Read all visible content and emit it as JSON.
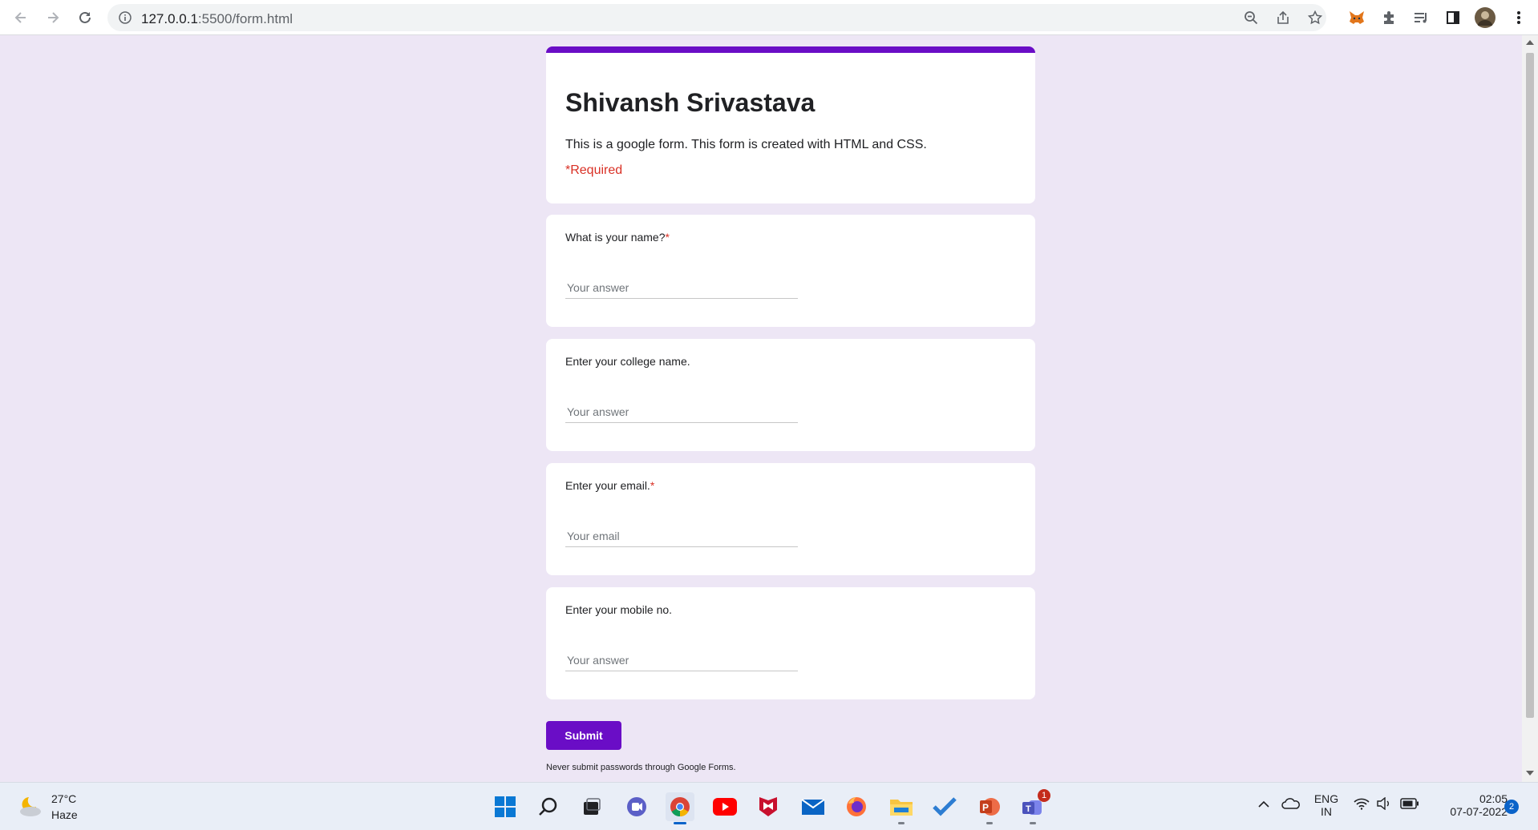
{
  "browser": {
    "url_host": "127.0.0.1",
    "url_rest": ":5500/form.html"
  },
  "form": {
    "title": "Shivansh Srivastava",
    "description": "This is a google form. This form is created with HTML and CSS.",
    "required_note": "*Required",
    "questions": [
      {
        "label": "What is your name?",
        "required": "*",
        "placeholder": "Your answer"
      },
      {
        "label": "Enter your college name.",
        "required": "",
        "placeholder": "Your answer"
      },
      {
        "label": "Enter your email.",
        "required": "*",
        "placeholder": "Your email"
      },
      {
        "label": "Enter your mobile no.",
        "required": "",
        "placeholder": "Your answer"
      }
    ],
    "submit_label": "Submit",
    "footnote": "Never submit passwords through Google Forms.",
    "accent_color": "#6a0dc6"
  },
  "taskbar": {
    "weather_temp": "27°C",
    "weather_desc": "Haze",
    "lang_top": "ENG",
    "lang_bottom": "IN",
    "time": "02:05",
    "date": "07-07-2022",
    "notification_count": "2",
    "teams_badge": "1",
    "apps": [
      "start-icon",
      "search-icon",
      "task-view-icon",
      "chat-icon",
      "chrome-icon",
      "youtube-icon",
      "mcafee-icon",
      "mail-icon",
      "firefox-icon",
      "file-explorer-icon",
      "todo-icon",
      "powerpoint-icon",
      "teams-icon"
    ]
  }
}
